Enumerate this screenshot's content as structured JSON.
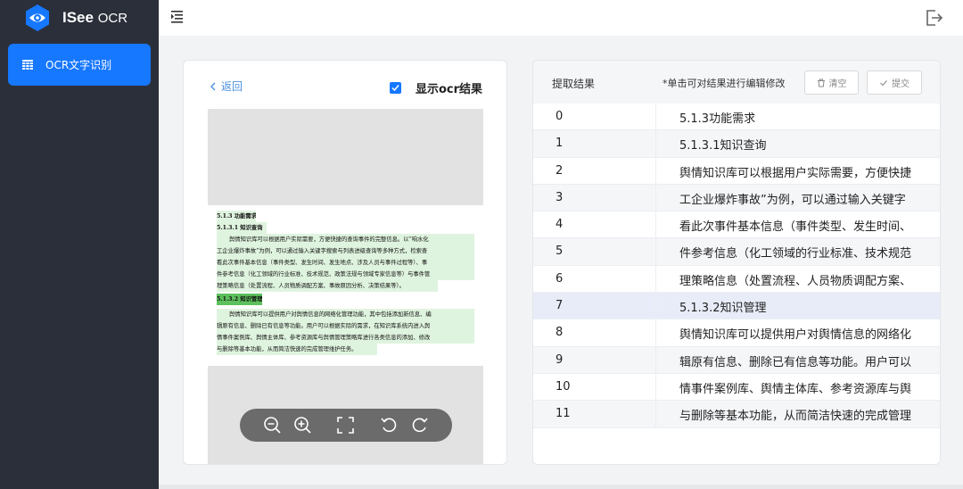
{
  "brand": {
    "name": "ISee",
    "suffix": "OCR",
    "logo_icon": "eye-logo-icon"
  },
  "sidebar": {
    "items": [
      {
        "label": "OCR文字识别",
        "icon": "grid-icon",
        "active": true
      }
    ]
  },
  "header": {
    "menu_icon": "menu-fold-icon",
    "logout_icon": "logout-icon"
  },
  "left_panel": {
    "back_label": "返回",
    "ocr_toggle_label": "显示ocr结果",
    "ocr_toggle_checked": true,
    "document_lines": [
      "5.1.3 功能需求",
      "5.1.3.1 知识查询",
      "舆情知识库可以根据用户实际需要，方便快捷的查询事件的完整信息。以“响水化",
      "工企业爆炸事故”为例，可以通过输入关键字搜索与列表进级查询等多种方式，检索查",
      "看此次事件基本信息（事件类型、发生时间、发生地点、涉及人员与事件过程等）、事",
      "件参考信息（化工领域的行业标准、技术规范、政策法规与领域专家信息等）与事件管",
      "理策略信息（处置流程、人员物质调配方案、事故原因分析、决策结果等）。",
      "5.1.3.2 知识管理",
      "舆情知识库可以提供用户对舆情信息的网络化管理功能，其中包括添加新信息、编",
      "辑原有信息、删除已有信息等功能。用户可以根据实际的需求，在知识库系统内进入舆",
      "情事件案例库、舆情主体库、参考资源库与舆情管理策略库进行各类信息的添加、修改",
      "与删除等基本功能，从而简洁快速的完成管理维护任务。"
    ],
    "zoom_controls": [
      "zoom-out-icon",
      "zoom-in-icon",
      "fit-screen-icon",
      "rotate-left-icon",
      "rotate-right-icon"
    ]
  },
  "right_panel": {
    "title": "提取结果",
    "hint": "*单击可对结果进行编辑修改",
    "clear_label": "清空",
    "submit_label": "提交",
    "selected_index": 7,
    "rows": [
      {
        "index": "0",
        "text": "5.1.3功能需求"
      },
      {
        "index": "1",
        "text": "5.1.3.1知识查询"
      },
      {
        "index": "2",
        "text": "舆情知识库可以根据用户实际需要，方便快捷"
      },
      {
        "index": "3",
        "text": "工企业爆炸事故”为例，可以通过输入关键字"
      },
      {
        "index": "4",
        "text": "看此次事件基本信息（事件类型、发生时间、"
      },
      {
        "index": "5",
        "text": "件参考信息（化工领域的行业标准、技术规范"
      },
      {
        "index": "6",
        "text": "理策略信息（处置流程、人员物质调配方案、"
      },
      {
        "index": "7",
        "text": "5.1.3.2知识管理"
      },
      {
        "index": "8",
        "text": "舆情知识库可以提供用户对舆情信息的网络化"
      },
      {
        "index": "9",
        "text": "辑原有信息、删除已有信息等功能。用户可以"
      },
      {
        "index": "10",
        "text": "情事件案例库、舆情主体库、参考资源库与舆"
      },
      {
        "index": "11",
        "text": "与删除等基本功能，从而简洁快速的完成管理"
      }
    ]
  },
  "colors": {
    "sidebar_bg": "#2b2f3a",
    "accent": "#1677ff",
    "selected_row": "#e8ecf8",
    "ocr_highlight": "#dff4df"
  }
}
